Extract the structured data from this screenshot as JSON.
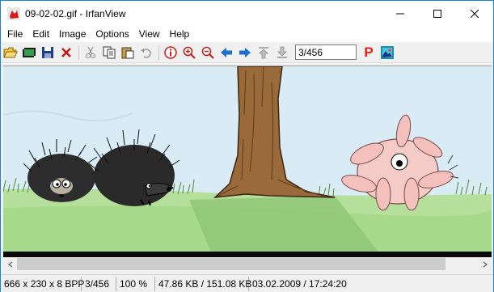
{
  "window": {
    "title": "09-02-02.gif - IrfanView",
    "controls": [
      "minimize",
      "maximize",
      "close"
    ]
  },
  "menu": {
    "items": [
      "File",
      "Edit",
      "Image",
      "Options",
      "View",
      "Help"
    ]
  },
  "toolbar": {
    "buttons": [
      "open-folder-icon",
      "slideshow-icon",
      "save-icon",
      "delete-icon",
      "cut-icon",
      "copy-icon",
      "paste-icon",
      "undo-icon",
      "info-icon",
      "zoom-in-icon",
      "zoom-out-icon",
      "previous-icon",
      "next-icon",
      "first-icon",
      "last-icon",
      "print-icon",
      "settings-icon"
    ],
    "page_value": "3/456",
    "print_label": "P"
  },
  "scrollbar": {
    "position": 0.0,
    "visible_fraction": 0.93
  },
  "status": {
    "dimensions": "666 x 230 x 8 BPP",
    "index": "3/456",
    "zoom": "100 %",
    "size": "47.86 KB / 151.08 KB",
    "datetime": "03.02.2009 / 17:24:20"
  },
  "colors": {
    "titlebar_border": "#1883d7",
    "sky": "#d8eaf4",
    "grass": "#a7d98a",
    "trunk": "#9a6a3a",
    "print_red": "#e0201b",
    "info_red": "#d32020",
    "arrow_blue": "#1c6fd1"
  }
}
